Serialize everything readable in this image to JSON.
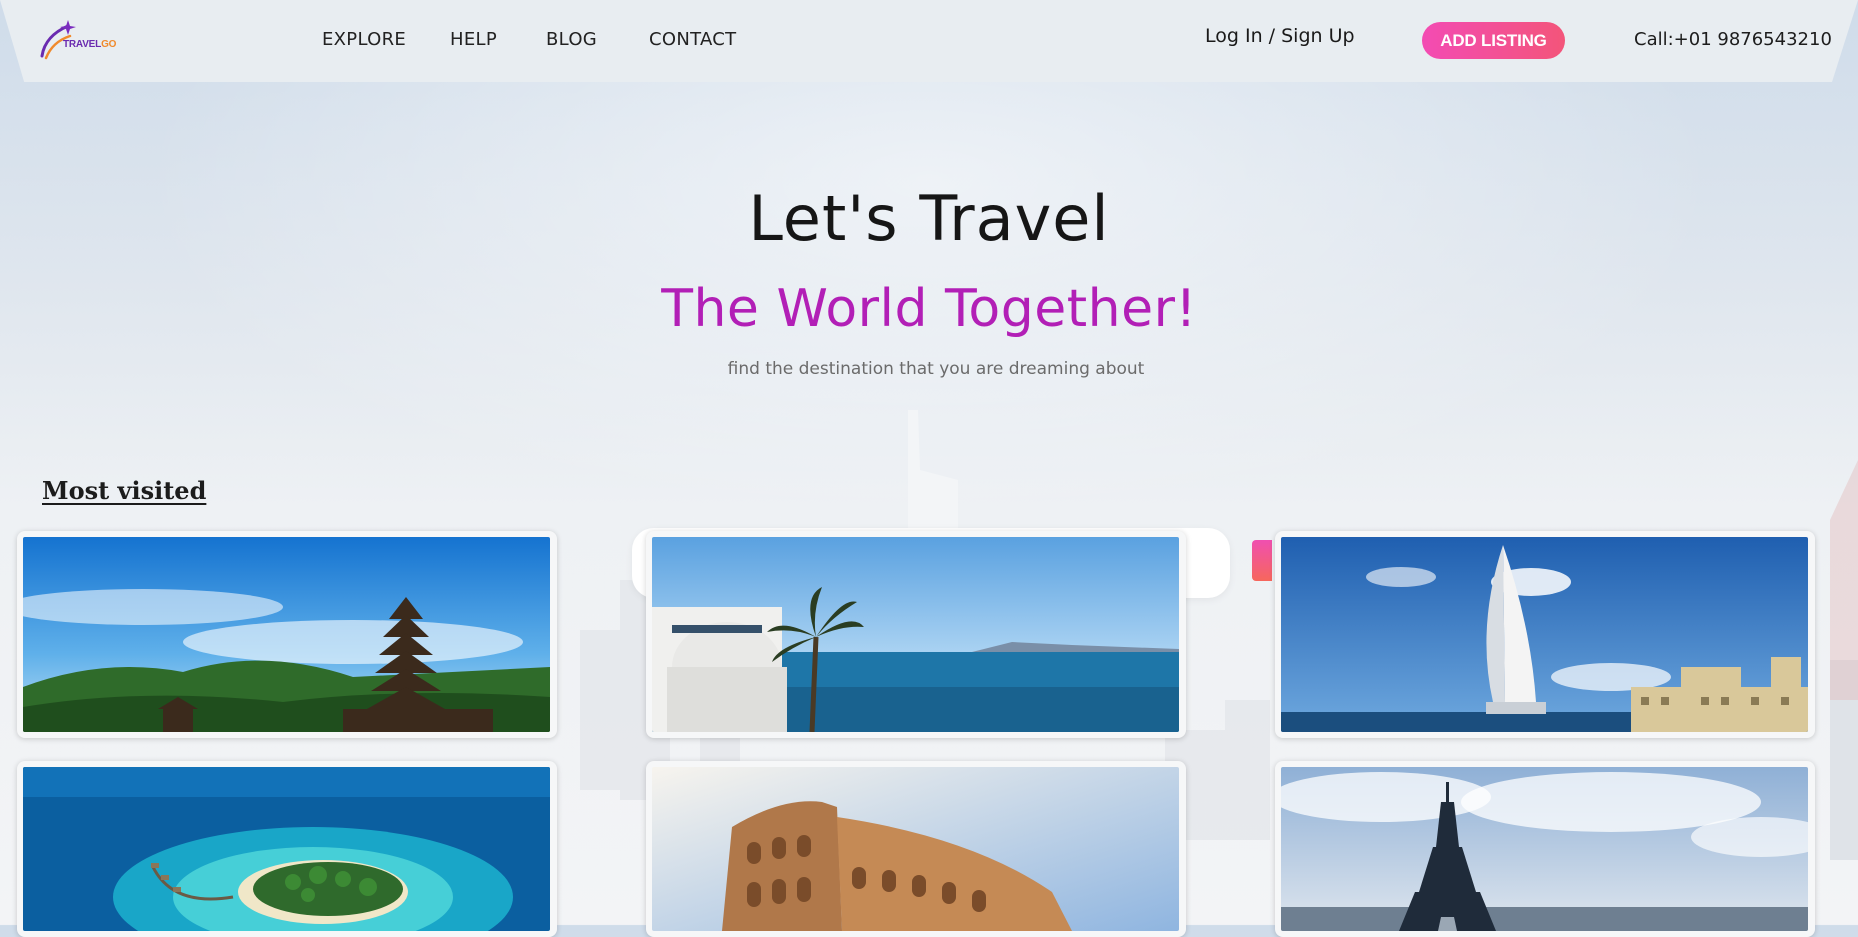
{
  "brand": {
    "logo_part1": "TRAVEL",
    "logo_part2": "GO"
  },
  "nav": {
    "explore": "EXPLORE",
    "help": "HELP",
    "blog": "BLOG",
    "contact": "CONTACT"
  },
  "auth": {
    "login_signup": "Log In / Sign Up"
  },
  "header": {
    "add_listing": "ADD LISTING",
    "phone": "Call:+01 9876543210"
  },
  "hero": {
    "title": "Let's Travel",
    "subtitle": "The World Together!",
    "tagline": "find the destination that you are dreaming about"
  },
  "sections": {
    "most_visited": "Most visited"
  },
  "colors": {
    "accent_magenta": "#b21fb6",
    "button_pink": "#f34bb3",
    "button_coral": "#f3557a",
    "logo_purple": "#6a2bb0",
    "logo_orange": "#f08a2c"
  },
  "destinations": [
    {
      "image": "temple-mountain-photo"
    },
    {
      "image": "sea-palm-dome-photo"
    },
    {
      "image": "burj-al-arab-photo"
    },
    {
      "image": "tropical-island-photo"
    },
    {
      "image": "colosseum-photo"
    },
    {
      "image": "eiffel-tower-photo"
    }
  ]
}
